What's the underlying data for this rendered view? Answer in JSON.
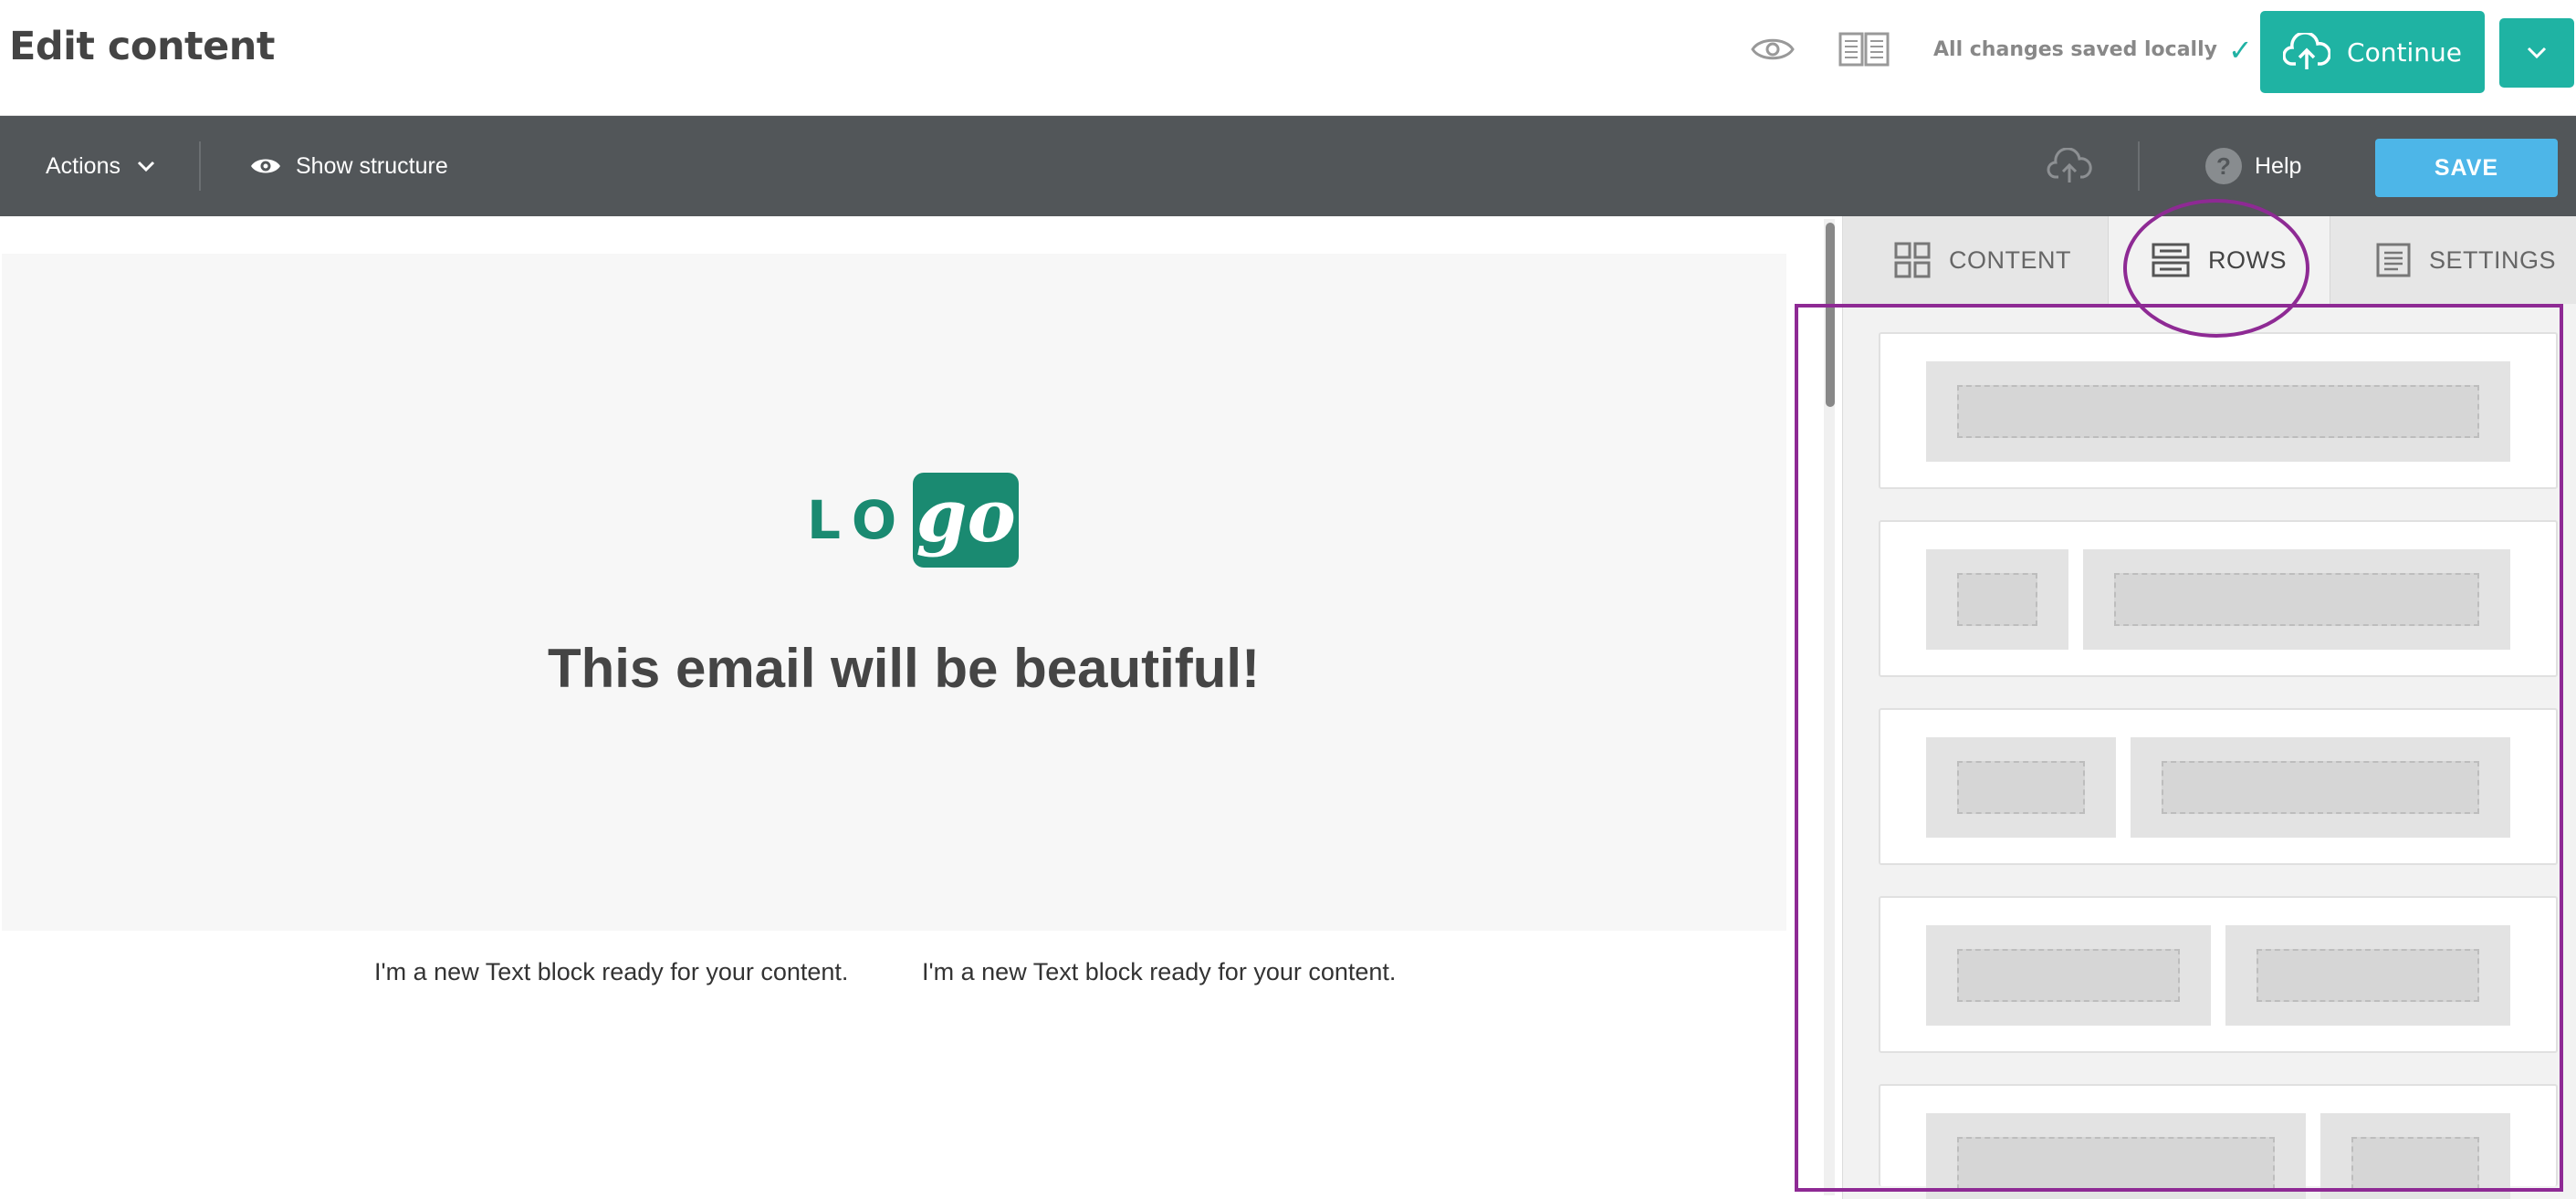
{
  "header": {
    "title": "Edit content",
    "save_status": "All changes saved locally",
    "save_status_check": "✓",
    "continue_label": "Continue",
    "icons": [
      "eye-icon",
      "book-icon",
      "cloud-upload-icon",
      "chevron-down-icon"
    ]
  },
  "toolbar": {
    "actions_label": "Actions",
    "show_structure_label": "Show structure",
    "help_label": "Help",
    "help_glyph": "?",
    "save_label": "SAVE"
  },
  "canvas": {
    "logo_left": "LO",
    "logo_right": "go",
    "heading": "This email will be beautiful!",
    "text_blocks": [
      "I'm a new Text block ready for your content.",
      "I'm a new Text block ready for your content."
    ]
  },
  "panel": {
    "tabs": [
      {
        "label": "CONTENT",
        "active": false
      },
      {
        "label": "ROWS",
        "active": true
      },
      {
        "label": "SETTINGS",
        "active": false
      }
    ],
    "row_layouts": [
      {
        "name": "1 column",
        "columns": [
          1
        ]
      },
      {
        "name": "1/4 - 3/4",
        "columns": [
          1,
          3
        ]
      },
      {
        "name": "1/3 - 2/3",
        "columns": [
          1,
          2
        ]
      },
      {
        "name": "1/2 - 1/2",
        "columns": [
          1,
          1
        ]
      },
      {
        "name": "2/3 - 1/3",
        "columns": [
          2,
          1
        ]
      }
    ]
  },
  "colors": {
    "accent": "#1fb3a3",
    "toolbar": "#525659",
    "save_button": "#4db6e8",
    "highlight": "#8e2a94",
    "logo": "#1a8a71"
  }
}
